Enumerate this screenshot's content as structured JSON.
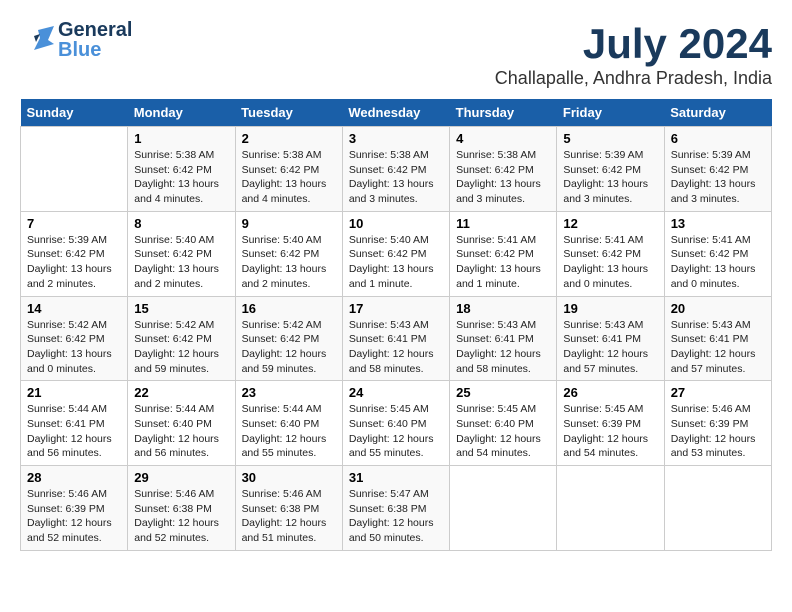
{
  "header": {
    "logo_line1": "General",
    "logo_line2": "Blue",
    "month_year": "July 2024",
    "location": "Challapalle, Andhra Pradesh, India"
  },
  "days_of_week": [
    "Sunday",
    "Monday",
    "Tuesday",
    "Wednesday",
    "Thursday",
    "Friday",
    "Saturday"
  ],
  "weeks": [
    [
      {
        "day": "",
        "sunrise": "",
        "sunset": "",
        "daylight": ""
      },
      {
        "day": "1",
        "sunrise": "Sunrise: 5:38 AM",
        "sunset": "Sunset: 6:42 PM",
        "daylight": "Daylight: 13 hours and 4 minutes."
      },
      {
        "day": "2",
        "sunrise": "Sunrise: 5:38 AM",
        "sunset": "Sunset: 6:42 PM",
        "daylight": "Daylight: 13 hours and 4 minutes."
      },
      {
        "day": "3",
        "sunrise": "Sunrise: 5:38 AM",
        "sunset": "Sunset: 6:42 PM",
        "daylight": "Daylight: 13 hours and 3 minutes."
      },
      {
        "day": "4",
        "sunrise": "Sunrise: 5:38 AM",
        "sunset": "Sunset: 6:42 PM",
        "daylight": "Daylight: 13 hours and 3 minutes."
      },
      {
        "day": "5",
        "sunrise": "Sunrise: 5:39 AM",
        "sunset": "Sunset: 6:42 PM",
        "daylight": "Daylight: 13 hours and 3 minutes."
      },
      {
        "day": "6",
        "sunrise": "Sunrise: 5:39 AM",
        "sunset": "Sunset: 6:42 PM",
        "daylight": "Daylight: 13 hours and 3 minutes."
      }
    ],
    [
      {
        "day": "7",
        "sunrise": "Sunrise: 5:39 AM",
        "sunset": "Sunset: 6:42 PM",
        "daylight": "Daylight: 13 hours and 2 minutes."
      },
      {
        "day": "8",
        "sunrise": "Sunrise: 5:40 AM",
        "sunset": "Sunset: 6:42 PM",
        "daylight": "Daylight: 13 hours and 2 minutes."
      },
      {
        "day": "9",
        "sunrise": "Sunrise: 5:40 AM",
        "sunset": "Sunset: 6:42 PM",
        "daylight": "Daylight: 13 hours and 2 minutes."
      },
      {
        "day": "10",
        "sunrise": "Sunrise: 5:40 AM",
        "sunset": "Sunset: 6:42 PM",
        "daylight": "Daylight: 13 hours and 1 minute."
      },
      {
        "day": "11",
        "sunrise": "Sunrise: 5:41 AM",
        "sunset": "Sunset: 6:42 PM",
        "daylight": "Daylight: 13 hours and 1 minute."
      },
      {
        "day": "12",
        "sunrise": "Sunrise: 5:41 AM",
        "sunset": "Sunset: 6:42 PM",
        "daylight": "Daylight: 13 hours and 0 minutes."
      },
      {
        "day": "13",
        "sunrise": "Sunrise: 5:41 AM",
        "sunset": "Sunset: 6:42 PM",
        "daylight": "Daylight: 13 hours and 0 minutes."
      }
    ],
    [
      {
        "day": "14",
        "sunrise": "Sunrise: 5:42 AM",
        "sunset": "Sunset: 6:42 PM",
        "daylight": "Daylight: 13 hours and 0 minutes."
      },
      {
        "day": "15",
        "sunrise": "Sunrise: 5:42 AM",
        "sunset": "Sunset: 6:42 PM",
        "daylight": "Daylight: 12 hours and 59 minutes."
      },
      {
        "day": "16",
        "sunrise": "Sunrise: 5:42 AM",
        "sunset": "Sunset: 6:42 PM",
        "daylight": "Daylight: 12 hours and 59 minutes."
      },
      {
        "day": "17",
        "sunrise": "Sunrise: 5:43 AM",
        "sunset": "Sunset: 6:41 PM",
        "daylight": "Daylight: 12 hours and 58 minutes."
      },
      {
        "day": "18",
        "sunrise": "Sunrise: 5:43 AM",
        "sunset": "Sunset: 6:41 PM",
        "daylight": "Daylight: 12 hours and 58 minutes."
      },
      {
        "day": "19",
        "sunrise": "Sunrise: 5:43 AM",
        "sunset": "Sunset: 6:41 PM",
        "daylight": "Daylight: 12 hours and 57 minutes."
      },
      {
        "day": "20",
        "sunrise": "Sunrise: 5:43 AM",
        "sunset": "Sunset: 6:41 PM",
        "daylight": "Daylight: 12 hours and 57 minutes."
      }
    ],
    [
      {
        "day": "21",
        "sunrise": "Sunrise: 5:44 AM",
        "sunset": "Sunset: 6:41 PM",
        "daylight": "Daylight: 12 hours and 56 minutes."
      },
      {
        "day": "22",
        "sunrise": "Sunrise: 5:44 AM",
        "sunset": "Sunset: 6:40 PM",
        "daylight": "Daylight: 12 hours and 56 minutes."
      },
      {
        "day": "23",
        "sunrise": "Sunrise: 5:44 AM",
        "sunset": "Sunset: 6:40 PM",
        "daylight": "Daylight: 12 hours and 55 minutes."
      },
      {
        "day": "24",
        "sunrise": "Sunrise: 5:45 AM",
        "sunset": "Sunset: 6:40 PM",
        "daylight": "Daylight: 12 hours and 55 minutes."
      },
      {
        "day": "25",
        "sunrise": "Sunrise: 5:45 AM",
        "sunset": "Sunset: 6:40 PM",
        "daylight": "Daylight: 12 hours and 54 minutes."
      },
      {
        "day": "26",
        "sunrise": "Sunrise: 5:45 AM",
        "sunset": "Sunset: 6:39 PM",
        "daylight": "Daylight: 12 hours and 54 minutes."
      },
      {
        "day": "27",
        "sunrise": "Sunrise: 5:46 AM",
        "sunset": "Sunset: 6:39 PM",
        "daylight": "Daylight: 12 hours and 53 minutes."
      }
    ],
    [
      {
        "day": "28",
        "sunrise": "Sunrise: 5:46 AM",
        "sunset": "Sunset: 6:39 PM",
        "daylight": "Daylight: 12 hours and 52 minutes."
      },
      {
        "day": "29",
        "sunrise": "Sunrise: 5:46 AM",
        "sunset": "Sunset: 6:38 PM",
        "daylight": "Daylight: 12 hours and 52 minutes."
      },
      {
        "day": "30",
        "sunrise": "Sunrise: 5:46 AM",
        "sunset": "Sunset: 6:38 PM",
        "daylight": "Daylight: 12 hours and 51 minutes."
      },
      {
        "day": "31",
        "sunrise": "Sunrise: 5:47 AM",
        "sunset": "Sunset: 6:38 PM",
        "daylight": "Daylight: 12 hours and 50 minutes."
      },
      {
        "day": "",
        "sunrise": "",
        "sunset": "",
        "daylight": ""
      },
      {
        "day": "",
        "sunrise": "",
        "sunset": "",
        "daylight": ""
      },
      {
        "day": "",
        "sunrise": "",
        "sunset": "",
        "daylight": ""
      }
    ]
  ]
}
